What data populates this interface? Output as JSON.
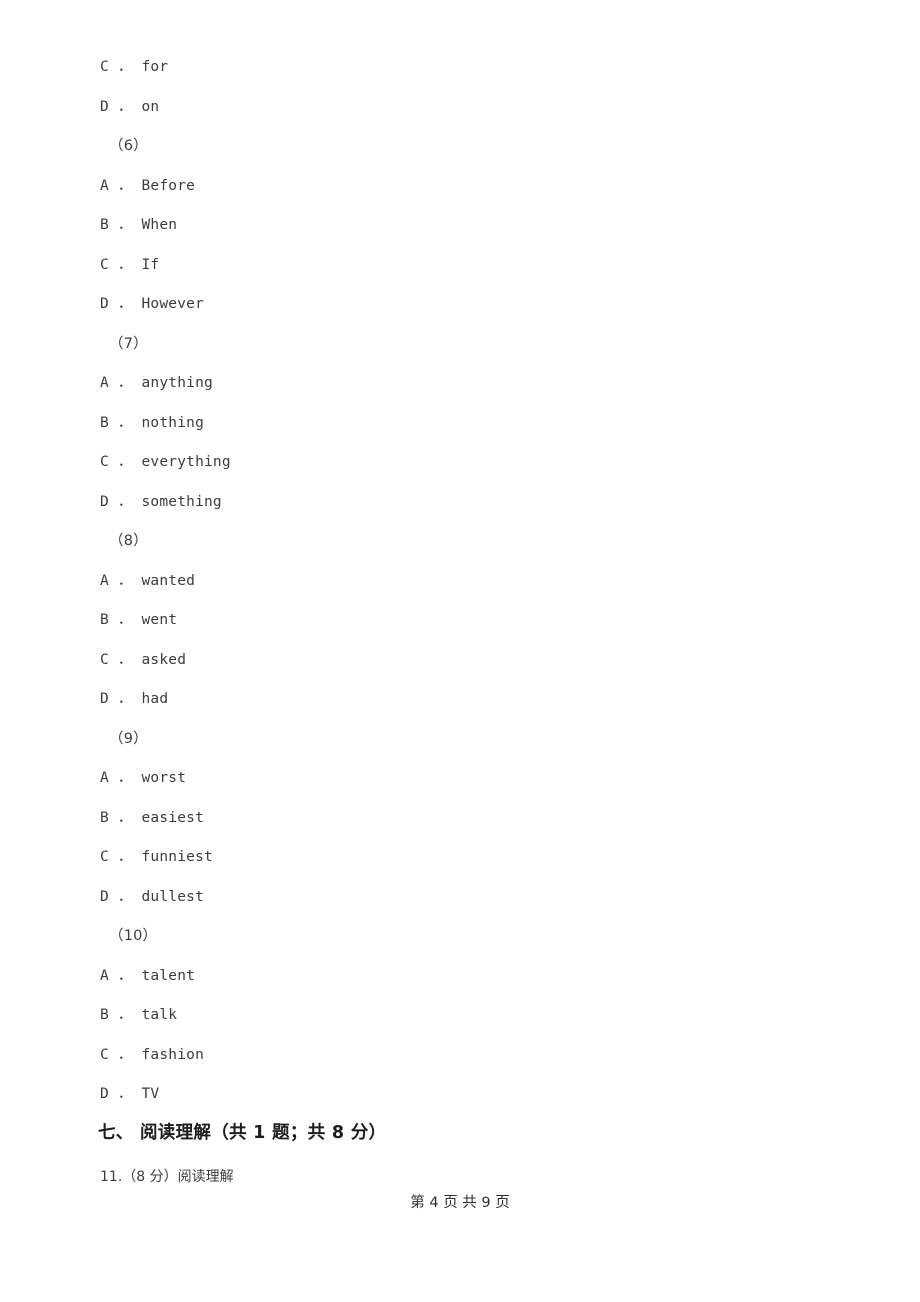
{
  "document": {
    "background_color": "#ffffff",
    "text_color": "#3c3c3c",
    "heading_color": "#1d1d1d"
  },
  "body_lines": [
    {
      "kind": "option",
      "text": "C ． for"
    },
    {
      "kind": "option",
      "text": "D ． on"
    },
    {
      "kind": "marker",
      "text": "（6）"
    },
    {
      "kind": "option",
      "text": "A ． Before"
    },
    {
      "kind": "option",
      "text": "B ． When"
    },
    {
      "kind": "option",
      "text": "C ． If"
    },
    {
      "kind": "option",
      "text": "D ． However"
    },
    {
      "kind": "marker",
      "text": "（7）"
    },
    {
      "kind": "option",
      "text": "A ． anything"
    },
    {
      "kind": "option",
      "text": "B ． nothing"
    },
    {
      "kind": "option",
      "text": "C ． everything"
    },
    {
      "kind": "option",
      "text": "D ． something"
    },
    {
      "kind": "marker",
      "text": "（8）"
    },
    {
      "kind": "option",
      "text": "A ． wanted"
    },
    {
      "kind": "option",
      "text": "B ． went"
    },
    {
      "kind": "option",
      "text": "C ． asked"
    },
    {
      "kind": "option",
      "text": "D ． had"
    },
    {
      "kind": "marker",
      "text": "（9）"
    },
    {
      "kind": "option",
      "text": "A ． worst"
    },
    {
      "kind": "option",
      "text": "B ． easiest"
    },
    {
      "kind": "option",
      "text": "C ． funniest"
    },
    {
      "kind": "option",
      "text": "D ． dullest"
    },
    {
      "kind": "marker",
      "text": "（10）"
    },
    {
      "kind": "option",
      "text": "A ． talent"
    },
    {
      "kind": "option",
      "text": "B ． talk"
    },
    {
      "kind": "option",
      "text": "C ． fashion"
    },
    {
      "kind": "option",
      "text": "D ． TV"
    }
  ],
  "section": {
    "heading": "七、 阅读理解（共 1 题；共 8 分）",
    "question": "11.（8 分）阅读理解"
  },
  "footer": {
    "page_label": "第 4 页 共 9 页",
    "current_page": "4",
    "total_pages": "9"
  }
}
